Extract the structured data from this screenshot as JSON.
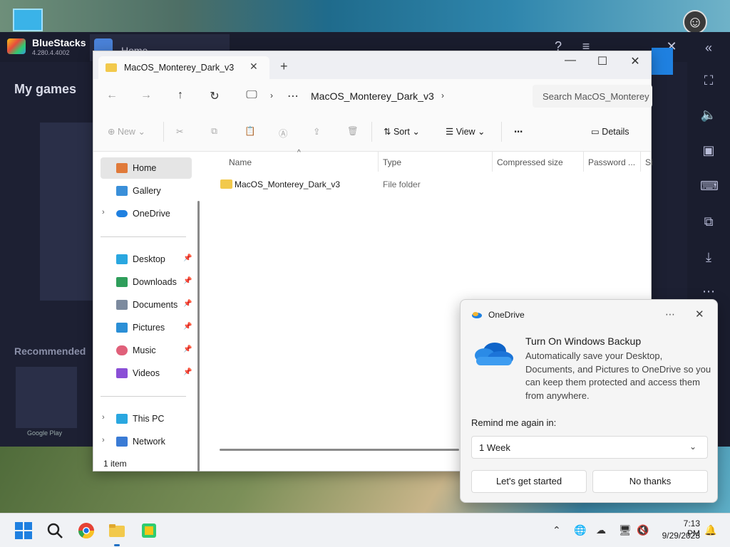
{
  "bluestacks": {
    "name": "BlueStacks",
    "version": "4.280.4.4002",
    "home_tab": "Home",
    "my_games": "My games",
    "recommended": "Recommended",
    "google_play": "Google Play"
  },
  "explorer": {
    "tab_label": "MacOS_Monterey_Dark_v3",
    "breadcrumb": [
      "MacOS_Monterey_Dark_v3"
    ],
    "search_placeholder": "Search MacOS_Monterey",
    "commands": {
      "new": "New",
      "sort": "Sort",
      "view": "View",
      "details": "Details"
    },
    "nav": {
      "home": "Home",
      "gallery": "Gallery",
      "onedrive": "OneDrive",
      "desktop": "Desktop",
      "downloads": "Downloads",
      "documents": "Documents",
      "pictures": "Pictures",
      "music": "Music",
      "videos": "Videos",
      "this_pc": "This PC",
      "network": "Network"
    },
    "columns": {
      "name": "Name",
      "type": "Type",
      "compressed_size": "Compressed size",
      "password": "Password ...",
      "size": "Si"
    },
    "rows": [
      {
        "name": "MacOS_Monterey_Dark_v3",
        "type": "File folder"
      }
    ],
    "status": "1 item"
  },
  "toast": {
    "app": "OneDrive",
    "title": "Turn On Windows Backup",
    "body": "Automatically save your Desktop, Documents, and Pictures to OneDrive so you can keep them protected and access them from anywhere.",
    "remind_label": "Remind me again in:",
    "remind_value": "1 Week",
    "primary_button": "Let's get started",
    "secondary_button": "No thanks"
  },
  "taskbar": {
    "time": "7:13 PM",
    "date": "9/29/2023"
  },
  "colors": {
    "accent": "#1f6fc4",
    "folder": "#f2c94c",
    "bluestacks_bg": "#1d2033"
  }
}
